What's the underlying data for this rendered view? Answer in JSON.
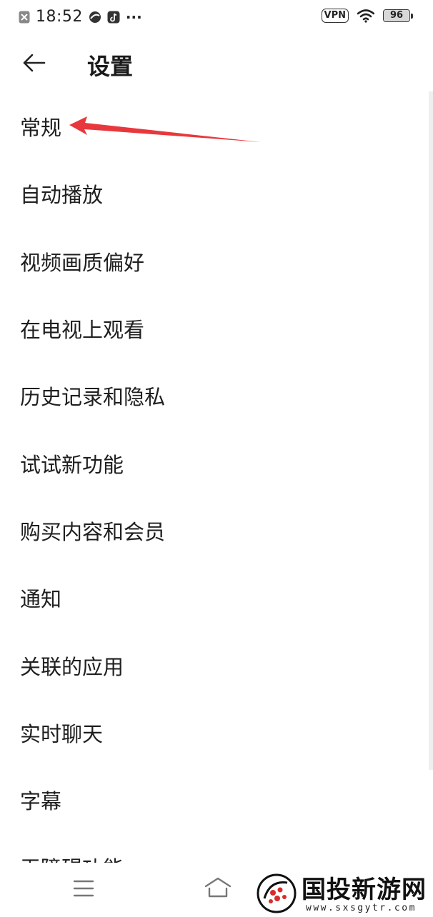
{
  "status_bar": {
    "time": "18:52",
    "vpn_label": "VPN",
    "battery_level": "96",
    "dots": "···"
  },
  "header": {
    "title": "设置"
  },
  "settings_items": [
    {
      "label": "常规"
    },
    {
      "label": "自动播放"
    },
    {
      "label": "视频画质偏好"
    },
    {
      "label": "在电视上观看"
    },
    {
      "label": "历史记录和隐私"
    },
    {
      "label": "试试新功能"
    },
    {
      "label": "购买内容和会员"
    },
    {
      "label": "通知"
    },
    {
      "label": "关联的应用"
    },
    {
      "label": "实时聊天"
    },
    {
      "label": "字幕"
    },
    {
      "label": "无障碍功能"
    }
  ],
  "watermark": {
    "name": "国投新游网",
    "url": "www.sxsgytr.com"
  },
  "colors": {
    "annotation_arrow": "#e8383d",
    "text": "#1f1f1f",
    "background": "#ffffff"
  },
  "icons": {
    "back": "arrow-left-icon",
    "nav_menu": "menu-icon",
    "nav_home": "home-icon"
  }
}
